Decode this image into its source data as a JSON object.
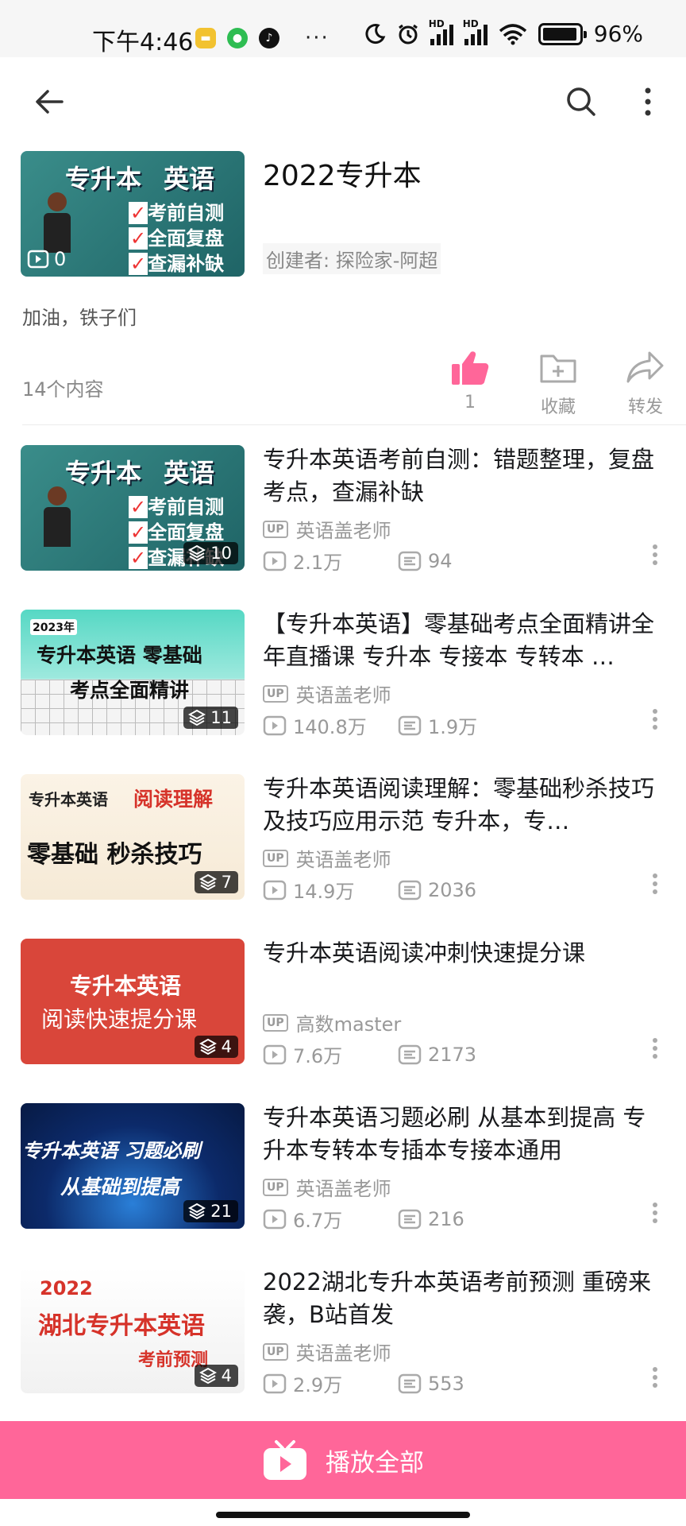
{
  "status_bar": {
    "time": "下午4:46",
    "more": "···",
    "battery": "96%",
    "battery_level": 0.96
  },
  "nav": {
    "back_icon": "arrow-left-icon",
    "search_icon": "search-icon",
    "more_icon": "more-vertical-icon"
  },
  "playlist": {
    "title": "2022专升本",
    "creator": "创建者: 探险家-阿超",
    "description": "加油，铁子们",
    "content_count": "14个内容",
    "cover_count": "0",
    "cover_title_1": "专升本",
    "cover_title_2": "英语",
    "cover_checks": [
      "考前自测",
      "全面复盘",
      "查漏补缺"
    ],
    "like_count": "1",
    "favorite_label": "收藏",
    "share_label": "转发",
    "accent_color": "#ff6699"
  },
  "videos": [
    {
      "title": "专升本英语考前自测：错题整理，复盘考点，查漏补缺",
      "uploader": "英语盖老师",
      "views": "2.1万",
      "danmaku": "94",
      "episodes": "10",
      "thumb_text": [
        "专升本",
        "英语",
        "考前自测",
        "全面复盘",
        "查漏补缺"
      ]
    },
    {
      "title": "【专升本英语】零基础考点全面精讲全年直播课 专升本 专接本 专转本 …",
      "uploader": "英语盖老师",
      "views": "140.8万",
      "danmaku": "1.9万",
      "episodes": "11",
      "thumb_text": [
        "2023年",
        "专升本英语  零基础",
        "考点全面精讲"
      ]
    },
    {
      "title": "专升本英语阅读理解：零基础秒杀技巧及技巧应用示范  专升本，专…",
      "uploader": "英语盖老师",
      "views": "14.9万",
      "danmaku": "2036",
      "episodes": "7",
      "thumb_text": [
        "专升本英语",
        "阅读理解",
        "零基础  秒杀技巧"
      ]
    },
    {
      "title": "专升本英语阅读冲刺快速提分课",
      "uploader": "高数master",
      "views": "7.6万",
      "danmaku": "2173",
      "episodes": "4",
      "thumb_text": [
        "专升本英语",
        "阅读快速提分课"
      ]
    },
    {
      "title": "专升本英语习题必刷 从基本到提高 专升本专转本专插本专接本通用",
      "uploader": "英语盖老师",
      "views": "6.7万",
      "danmaku": "216",
      "episodes": "21",
      "thumb_text": [
        "专升本英语  习题必刷",
        "从基础到提高"
      ]
    },
    {
      "title": "2022湖北专升本英语考前预测  重磅来袭，B站首发",
      "uploader": "英语盖老师",
      "views": "2.9万",
      "danmaku": "553",
      "episodes": "4",
      "thumb_text": [
        "2022",
        "湖北专升本英语",
        "考前预测"
      ]
    }
  ],
  "up_tag": "UP",
  "bottom": {
    "play_all_label": "播放全部"
  }
}
